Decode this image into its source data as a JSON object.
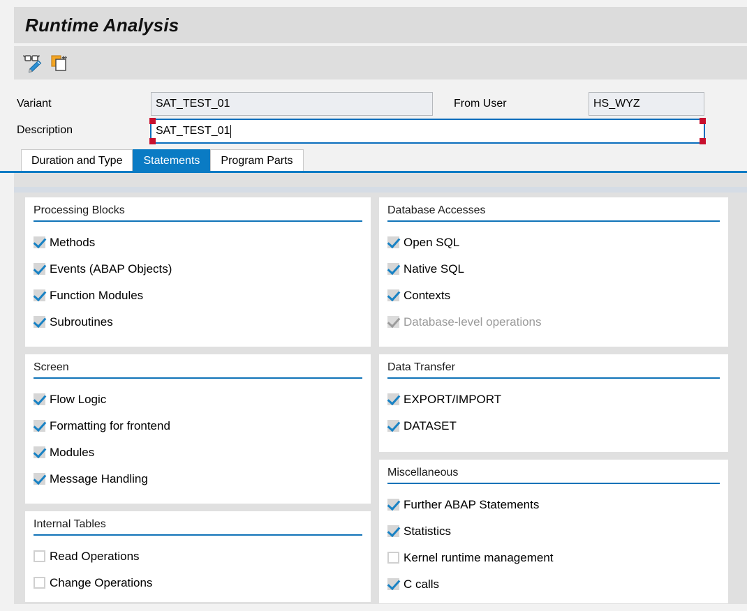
{
  "window": {
    "title": "Runtime Analysis"
  },
  "toolbar": {
    "buttons": [
      {
        "name": "display-change-icon",
        "tooltip": "Display/Change"
      },
      {
        "name": "copy-icon",
        "tooltip": "Create Using Template"
      }
    ]
  },
  "form": {
    "variant_label": "Variant",
    "variant_value": "SAT_TEST_01",
    "from_user_label": "From User",
    "from_user_value": "HS_WYZ",
    "description_label": "Description",
    "description_value": "SAT_TEST_01"
  },
  "tabs": [
    {
      "label": "Duration and Type",
      "active": false
    },
    {
      "label": "Statements",
      "active": true
    },
    {
      "label": "Program Parts",
      "active": false
    }
  ],
  "panels": {
    "left": [
      {
        "title": "Processing Blocks",
        "size": "p-proc",
        "items": [
          {
            "label": "Methods",
            "checked": true,
            "disabled": false
          },
          {
            "label": "Events (ABAP Objects)",
            "checked": true,
            "disabled": false
          },
          {
            "label": "Function Modules",
            "checked": true,
            "disabled": false
          },
          {
            "label": "Subroutines",
            "checked": true,
            "disabled": false
          }
        ]
      },
      {
        "title": "Screen",
        "size": "p-screen",
        "items": [
          {
            "label": "Flow Logic",
            "checked": true,
            "disabled": false
          },
          {
            "label": "Formatting for frontend",
            "checked": true,
            "disabled": false
          },
          {
            "label": "Modules",
            "checked": true,
            "disabled": false
          },
          {
            "label": "Message Handling",
            "checked": true,
            "disabled": false
          }
        ]
      },
      {
        "title": "Internal Tables",
        "size": "p-intern",
        "items": [
          {
            "label": "Read Operations",
            "checked": false,
            "disabled": false
          },
          {
            "label": "Change Operations",
            "checked": false,
            "disabled": false
          }
        ]
      }
    ],
    "right": [
      {
        "title": "Database Accesses",
        "size": "p-db",
        "items": [
          {
            "label": "Open SQL",
            "checked": true,
            "disabled": false
          },
          {
            "label": "Native SQL",
            "checked": true,
            "disabled": false
          },
          {
            "label": "Contexts",
            "checked": true,
            "disabled": false
          },
          {
            "label": "Database-level operations",
            "checked": true,
            "disabled": true
          }
        ]
      },
      {
        "title": "Data Transfer",
        "size": "p-data",
        "items": [
          {
            "label": "EXPORT/IMPORT",
            "checked": true,
            "disabled": false
          },
          {
            "label": "DATASET",
            "checked": true,
            "disabled": false
          }
        ]
      },
      {
        "title": "Miscellaneous",
        "size": "p-misc",
        "items": [
          {
            "label": "Further ABAP Statements",
            "checked": true,
            "disabled": false
          },
          {
            "label": "Statistics",
            "checked": true,
            "disabled": false
          },
          {
            "label": "Kernel runtime management",
            "checked": false,
            "disabled": false
          },
          {
            "label": "C calls",
            "checked": true,
            "disabled": false
          }
        ]
      }
    ]
  },
  "colors": {
    "accent": "#0a7bc4",
    "panel_rule": "#1073b8",
    "focus_corner": "#c8102e",
    "checkbox_tick": "#1982c4",
    "background": "#e0e0e0"
  }
}
